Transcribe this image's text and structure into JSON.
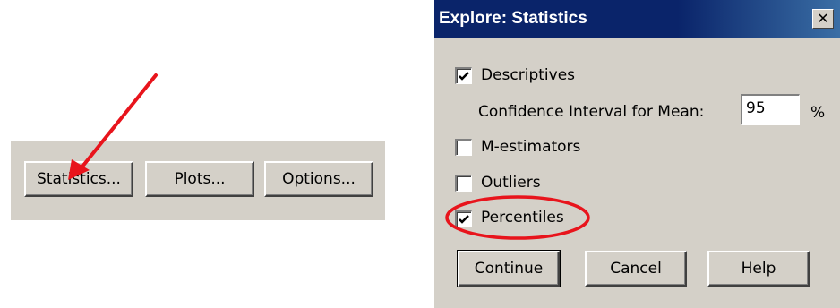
{
  "toolbar": {
    "statistics_label": "Statistics...",
    "plots_label": "Plots...",
    "options_label": "Options..."
  },
  "dialog": {
    "title": "Explore: Statistics",
    "close_glyph": "✕",
    "descriptives": {
      "label": "Descriptives",
      "checked": true
    },
    "confidence": {
      "label": "Confidence Interval for Mean:",
      "value": "95",
      "unit": "%"
    },
    "m_estimators": {
      "label": "M-estimators",
      "checked": false
    },
    "outliers": {
      "label": "Outliers",
      "checked": false
    },
    "percentiles": {
      "label": "Percentiles",
      "checked": true
    },
    "buttons": {
      "continue": "Continue",
      "cancel": "Cancel",
      "help": "Help"
    }
  },
  "annotations": {
    "arrow_color": "#e8141c",
    "circle_color": "#e8141c"
  }
}
